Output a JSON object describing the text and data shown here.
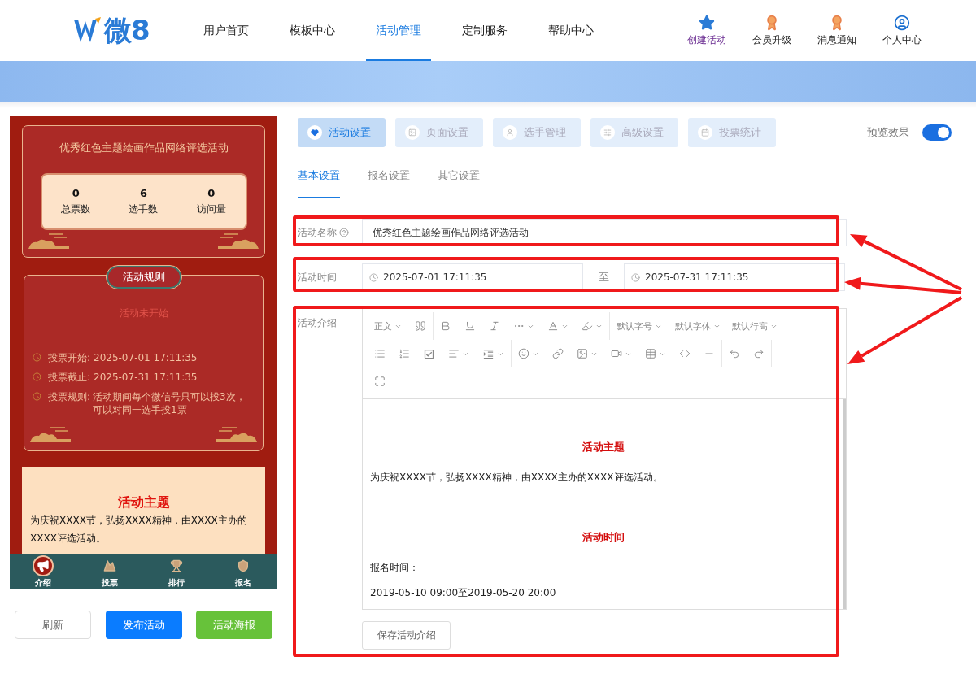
{
  "header": {
    "logo": "微8",
    "nav": [
      {
        "label": "用户首页",
        "selected": false
      },
      {
        "label": "模板中心",
        "selected": false
      },
      {
        "label": "活动管理",
        "selected": true
      },
      {
        "label": "定制服务",
        "selected": false
      },
      {
        "label": "帮助中心",
        "selected": false
      }
    ],
    "actions": [
      {
        "label": "创建活动",
        "kind": "create"
      },
      {
        "label": "会员升级",
        "kind": "badge"
      },
      {
        "label": "消息通知",
        "kind": "badge"
      },
      {
        "label": "个人中心",
        "kind": "user"
      }
    ]
  },
  "preview": {
    "title": "优秀红色主题绘画作品网络评选活动",
    "stats": [
      {
        "value": "0",
        "label": "总票数"
      },
      {
        "value": "6",
        "label": "选手数"
      },
      {
        "value": "0",
        "label": "访问量"
      }
    ],
    "rules_badge": "活动规则",
    "status": "活动未开始",
    "rules": [
      {
        "label": "投票开始:",
        "value": "2025-07-01 17:11:35"
      },
      {
        "label": "投票截止:",
        "value": "2025-07-31 17:11:35"
      },
      {
        "label": "投票规则:",
        "value": "活动期间每个微信号只可以投3次，可以对同一选手投1票"
      }
    ],
    "intro": {
      "title": "活动主题",
      "text": "为庆祝XXXX节，弘扬XXXX精神，由XXXX主办的XXXX评选活动。"
    },
    "bottom_nav": [
      {
        "label": "介绍",
        "selected": true
      },
      {
        "label": "投票",
        "selected": false
      },
      {
        "label": "排行",
        "selected": false
      },
      {
        "label": "报名",
        "selected": false
      }
    ]
  },
  "buttons": [
    {
      "label": "刷新",
      "kind": "plain"
    },
    {
      "label": "发布活动",
      "kind": "primary"
    },
    {
      "label": "活动海报",
      "kind": "success"
    }
  ],
  "tabs": [
    {
      "label": "活动设置",
      "selected": true
    },
    {
      "label": "页面设置",
      "selected": false
    },
    {
      "label": "选手管理",
      "selected": false
    },
    {
      "label": "高级设置",
      "selected": false
    },
    {
      "label": "投票统计",
      "selected": false
    }
  ],
  "preview_toggle": {
    "label": "预览效果",
    "on": true
  },
  "subtabs": [
    {
      "label": "基本设置",
      "selected": true
    },
    {
      "label": "报名设置",
      "selected": false
    },
    {
      "label": "其它设置",
      "selected": false
    }
  ],
  "form": {
    "name": {
      "label": "活动名称",
      "value": "优秀红色主题绘画作品网络评选活动"
    },
    "time": {
      "label": "活动时间",
      "start": "2025-07-01 17:11:35",
      "separator": "至",
      "end": "2025-07-31 17:11:35"
    },
    "intro": {
      "label": "活动介绍",
      "toolbar_selects": [
        "正文",
        "默认字号",
        "默认字体",
        "默认行高"
      ],
      "content": [
        {
          "kind": "heading",
          "text": "活动主题"
        },
        {
          "kind": "paragraph",
          "text": "为庆祝XXXX节，弘扬XXXX精神，由XXXX主办的XXXX评选活动。"
        },
        {
          "kind": "heading",
          "text": "活动时间"
        },
        {
          "kind": "paragraph",
          "text": "报名时间："
        },
        {
          "kind": "paragraph",
          "text": "2019-05-10 09:00至2019-05-20 20:00"
        }
      ],
      "save": "保存活动介绍"
    }
  }
}
